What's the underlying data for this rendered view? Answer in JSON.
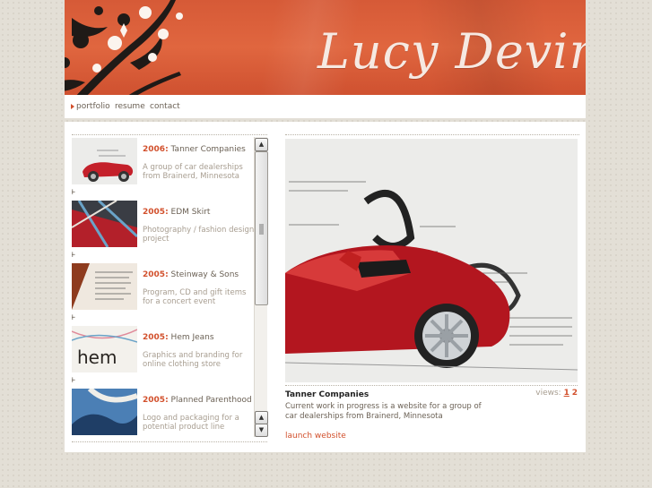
{
  "header": {
    "logo_text": "Lucy Devins"
  },
  "nav": {
    "items": [
      {
        "label": "portfolio"
      },
      {
        "label": "resume"
      },
      {
        "label": "contact"
      }
    ]
  },
  "portfolio_list": [
    {
      "year": "2006",
      "title": "Tanner Companies",
      "description": "A group of car dealerships from Brainerd, Minnesota"
    },
    {
      "year": "2005",
      "title": "EDM Skirt",
      "description": "Photography / fashion design project"
    },
    {
      "year": "2005",
      "title": "Steinway & Sons",
      "description": "Program, CD and gift items for a concert event"
    },
    {
      "year": "2005",
      "title": "Hem Jeans",
      "description": "Graphics and branding for online clothing store"
    },
    {
      "year": "2005",
      "title": "Planned Parenthood",
      "description": "Logo and packaging for a potential product line"
    }
  ],
  "list_separator": "+",
  "year_separator": ":",
  "hem_thumb_text": "hem",
  "detail": {
    "title": "Tanner Companies",
    "views_label": "views:",
    "views": [
      "1",
      "2"
    ],
    "description": "Current work in progress is a website for a group of car dealerships from Brainerd, Minnesota",
    "launch_label": "launch website"
  },
  "scroll": {
    "up_symbol": "▲",
    "down_symbol": "▼"
  },
  "colors": {
    "accent": "#d2502c",
    "header": "#e0663f",
    "text": "#6b6155",
    "muted": "#a79d90"
  }
}
